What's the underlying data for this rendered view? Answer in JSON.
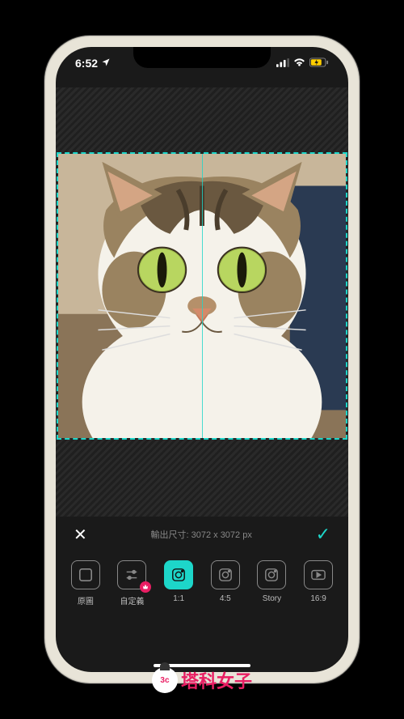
{
  "status": {
    "time": "6:52",
    "location_icon": "location-arrow"
  },
  "editor": {
    "output_label": "輸出尺寸:",
    "output_value": "3072 x 3072 px"
  },
  "actions": {
    "close": "✕",
    "confirm": "✓"
  },
  "ratio_options": [
    {
      "id": "original",
      "label": "原圖",
      "icon": "square-outline",
      "active": false
    },
    {
      "id": "custom",
      "label": "自定義",
      "icon": "sliders",
      "active": false,
      "badge": true
    },
    {
      "id": "1-1",
      "label": "1:1",
      "icon": "instagram",
      "active": true
    },
    {
      "id": "4-5",
      "label": "4:5",
      "icon": "instagram",
      "active": false
    },
    {
      "id": "story",
      "label": "Story",
      "icon": "instagram",
      "active": false
    },
    {
      "id": "16-9",
      "label": "16:9",
      "icon": "youtube",
      "active": false
    }
  ],
  "watermark": {
    "avatar_text": "3c",
    "text": "塔科女子"
  },
  "colors": {
    "accent": "#1dd6c9",
    "badge": "#e91e63"
  }
}
